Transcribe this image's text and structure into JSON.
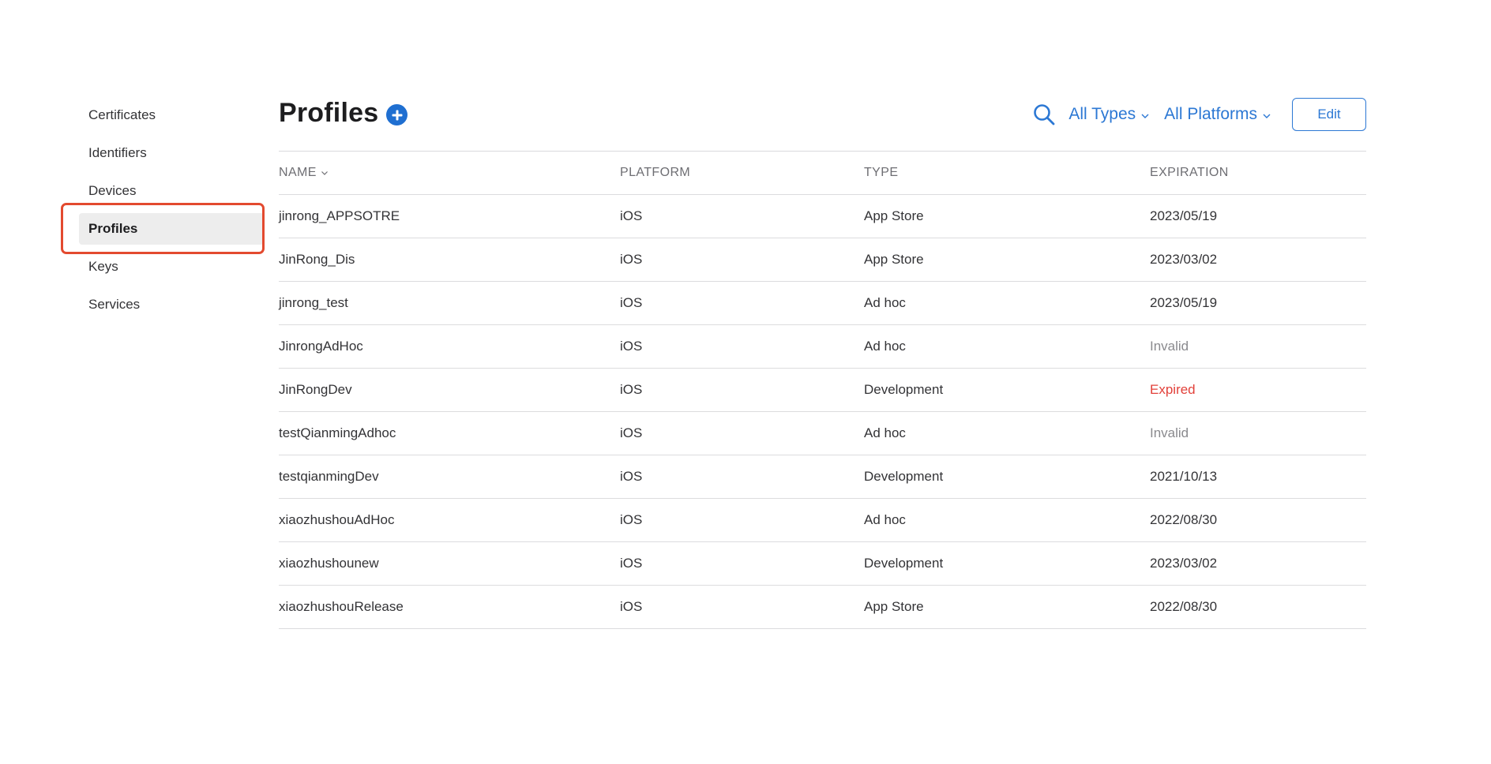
{
  "sidebar": {
    "items": [
      {
        "label": "Certificates",
        "active": false
      },
      {
        "label": "Identifiers",
        "active": false
      },
      {
        "label": "Devices",
        "active": false
      },
      {
        "label": "Profiles",
        "active": true
      },
      {
        "label": "Keys",
        "active": false
      },
      {
        "label": "Services",
        "active": false
      }
    ]
  },
  "header": {
    "title": "Profiles",
    "add_icon": "plus-circle-icon",
    "search_icon": "search-icon",
    "type_filter": "All Types",
    "platform_filter": "All Platforms",
    "edit_label": "Edit"
  },
  "table": {
    "columns": [
      "NAME",
      "PLATFORM",
      "TYPE",
      "EXPIRATION"
    ],
    "rows": [
      {
        "name": "jinrong_APPSOTRE",
        "platform": "iOS",
        "type": "App Store",
        "expiration": "2023/05/19"
      },
      {
        "name": "JinRong_Dis",
        "platform": "iOS",
        "type": "App Store",
        "expiration": "2023/03/02"
      },
      {
        "name": "jinrong_test",
        "platform": "iOS",
        "type": "Ad hoc",
        "expiration": "2023/05/19"
      },
      {
        "name": "JinrongAdHoc",
        "platform": "iOS",
        "type": "Ad hoc",
        "expiration": "Invalid"
      },
      {
        "name": "JinRongDev",
        "platform": "iOS",
        "type": "Development",
        "expiration": "Expired"
      },
      {
        "name": "testQianmingAdhoc",
        "platform": "iOS",
        "type": "Ad hoc",
        "expiration": "Invalid"
      },
      {
        "name": "testqianmingDev",
        "platform": "iOS",
        "type": "Development",
        "expiration": "2021/10/13"
      },
      {
        "name": "xiaozhushouAdHoc",
        "platform": "iOS",
        "type": "Ad hoc",
        "expiration": "2022/08/30"
      },
      {
        "name": "xiaozhushounew",
        "platform": "iOS",
        "type": "Development",
        "expiration": "2023/03/02"
      },
      {
        "name": "xiaozhushouRelease",
        "platform": "iOS",
        "type": "App Store",
        "expiration": "2022/08/30"
      }
    ]
  },
  "colors": {
    "accent": "#2c78d4",
    "add_button": "#1f6fd1",
    "expired": "#e2413a",
    "invalid": "#8a8a8e",
    "highlight_box": "#e34a2f",
    "active_bg": "#ededed"
  }
}
